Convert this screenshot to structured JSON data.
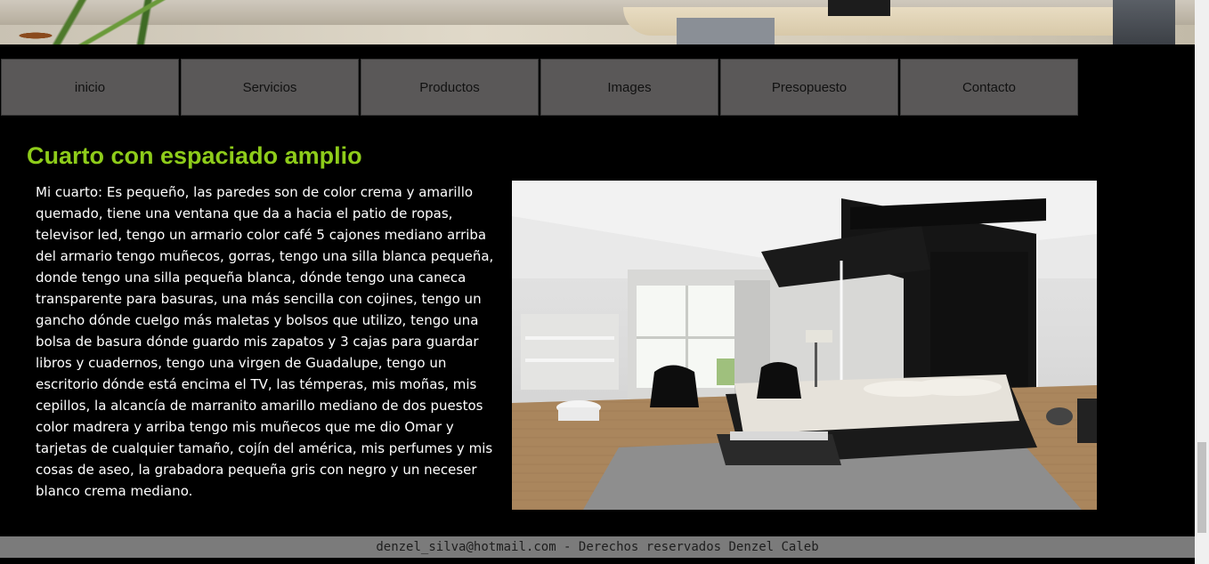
{
  "nav": {
    "items": [
      {
        "label": "inicio"
      },
      {
        "label": "Servicios"
      },
      {
        "label": "Productos"
      },
      {
        "label": "Images"
      },
      {
        "label": "Presopuesto"
      },
      {
        "label": "Contacto"
      }
    ]
  },
  "main": {
    "heading": "Cuarto con espaciado amplio",
    "paragraph": "Mi cuarto: Es pequeño, las paredes son de color crema y amarillo quemado, tiene una ventana que da a hacia el patio de ropas, televisor led, tengo un armario color café 5 cajones mediano arriba del armario tengo muñecos, gorras, tengo una silla blanca pequeña, donde tengo una silla pequeña blanca, dónde tengo una caneca transparente para basuras, una más sencilla con cojines, tengo un gancho dónde cuelgo más maletas y bolsos que utilizo, tengo una bolsa de basura dónde guardo mis zapatos y 3 cajas para guardar libros y cuadernos, tengo una virgen de Guadalupe, tengo un escritorio dónde está encima el TV, las témperas, mis moñas, mis cepillos, la alcancía de marranito amarillo mediano de dos puestos color madrera y arriba tengo mis muñecos que me dio Omar y tarjetas de cualquier tamaño, cojín del américa, mis perfumes y mis cosas de aseo, la grabadora pequeña gris con negro y un neceser blanco crema mediano."
  },
  "footer": {
    "text": "denzel_silva@hotmail.com - Derechos reservados Denzel Caleb"
  },
  "colors": {
    "heading": "#8ecc1a",
    "nav_bg": "#5a5858",
    "page_bg": "#000000",
    "footer_bg": "#7b7b7b"
  }
}
